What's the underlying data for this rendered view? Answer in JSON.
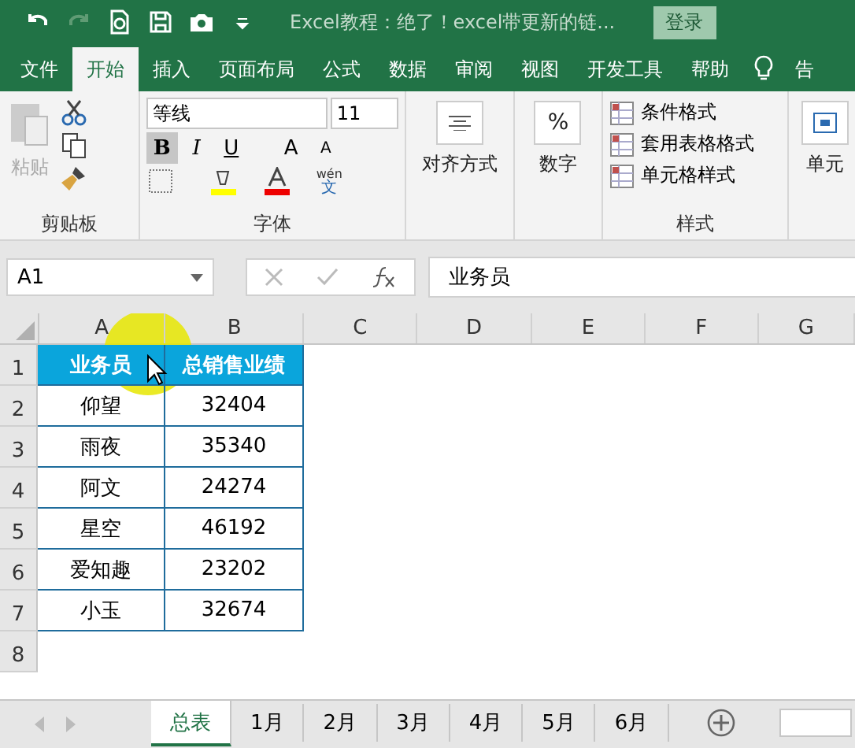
{
  "window": {
    "title": "Excel教程：绝了！excel带更新的链...",
    "login": "登录"
  },
  "ribbon_tabs": [
    {
      "label": "文件",
      "selected": false
    },
    {
      "label": "开始",
      "selected": true
    },
    {
      "label": "插入",
      "selected": false
    },
    {
      "label": "页面布局",
      "selected": false
    },
    {
      "label": "公式",
      "selected": false
    },
    {
      "label": "数据",
      "selected": false
    },
    {
      "label": "审阅",
      "selected": false
    },
    {
      "label": "视图",
      "selected": false
    },
    {
      "label": "开发工具",
      "selected": false
    },
    {
      "label": "帮助",
      "selected": false
    },
    {
      "label": "告",
      "selected": false
    }
  ],
  "ribbon": {
    "clipboard": {
      "paste": "粘贴",
      "label": "剪贴板"
    },
    "font": {
      "name": "等线",
      "size": "11",
      "buttons": [
        {
          "label": "B",
          "kind": "bold",
          "selected": true
        },
        {
          "label": "I",
          "kind": "italic",
          "selected": false
        },
        {
          "label": "U",
          "kind": "underline",
          "selected": false
        },
        {
          "label": "A",
          "kind": "grow",
          "selected": false
        },
        {
          "label": "A",
          "kind": "shrink",
          "selected": false
        }
      ],
      "phonetic": "wén",
      "phonetic_char": "文",
      "label": "字体"
    },
    "alignment": "对齐方式",
    "number": {
      "symbol": "%",
      "label": "数字"
    },
    "styles": {
      "items": [
        "条件格式",
        "套用表格格式",
        "单元格样式"
      ],
      "label": "样式"
    },
    "cells": "单元"
  },
  "formula_bar": {
    "name_box": "A1",
    "formula": "业务员"
  },
  "columns": [
    "A",
    "B",
    "C",
    "D",
    "E",
    "F",
    "G"
  ],
  "row_numbers": [
    "1",
    "2",
    "3",
    "4",
    "5",
    "6",
    "7",
    "8"
  ],
  "table": {
    "header": [
      "业务员",
      "总销售业绩"
    ],
    "rows": [
      [
        "仰望",
        "32404"
      ],
      [
        "雨夜",
        "35340"
      ],
      [
        "阿文",
        "24274"
      ],
      [
        "星空",
        "46192"
      ],
      [
        "爱知趣",
        "23202"
      ],
      [
        "小玉",
        "32674"
      ]
    ]
  },
  "sheet_tabs": [
    {
      "label": "总表",
      "selected": true
    },
    {
      "label": "1月",
      "selected": false
    },
    {
      "label": "2月",
      "selected": false
    },
    {
      "label": "3月",
      "selected": false
    },
    {
      "label": "4月",
      "selected": false
    },
    {
      "label": "5月",
      "selected": false
    },
    {
      "label": "6月",
      "selected": false
    }
  ]
}
